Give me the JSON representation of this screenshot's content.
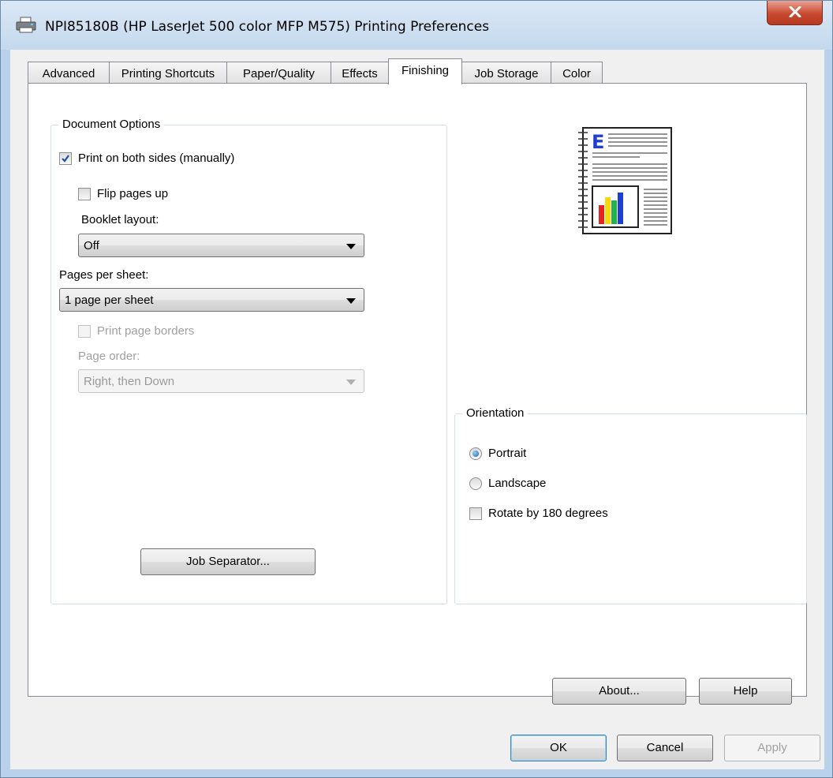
{
  "window": {
    "title": "NPI85180B (HP LaserJet 500 color MFP M575) Printing Preferences",
    "title_icon": "printer-icon",
    "close_icon": "close-icon"
  },
  "tabs": [
    {
      "label": "Advanced",
      "active": false
    },
    {
      "label": "Printing Shortcuts",
      "active": false
    },
    {
      "label": "Paper/Quality",
      "active": false
    },
    {
      "label": "Effects",
      "active": false
    },
    {
      "label": "Finishing",
      "active": true
    },
    {
      "label": "Job Storage",
      "active": false
    },
    {
      "label": "Color",
      "active": false
    }
  ],
  "document_options": {
    "group_label": "Document Options",
    "print_both_sides": {
      "label": "Print on both sides (manually)",
      "checked": true
    },
    "flip_pages_up": {
      "label": "Flip pages up",
      "checked": false
    },
    "booklet_layout": {
      "label": "Booklet layout:",
      "value": "Off"
    },
    "pages_per_sheet": {
      "label": "Pages per sheet:",
      "value": "1 page per sheet"
    },
    "print_page_borders": {
      "label": "Print page borders",
      "checked": false,
      "disabled": true
    },
    "page_order": {
      "label": "Page order:",
      "value": "Right, then Down",
      "disabled": true
    },
    "job_separator_button": "Job Separator..."
  },
  "preview": {
    "icon": "document-preview-icon",
    "letter": "E",
    "bar_colors": [
      "#e8231f",
      "#f5d90a",
      "#22b14c",
      "#1f3fd1"
    ]
  },
  "orientation": {
    "group_label": "Orientation",
    "portrait": {
      "label": "Portrait",
      "selected": true
    },
    "landscape": {
      "label": "Landscape",
      "selected": false
    },
    "rotate_180": {
      "label": "Rotate by 180 degrees",
      "checked": false
    }
  },
  "page_buttons": {
    "about": "About...",
    "help": "Help"
  },
  "dialog_buttons": {
    "ok": "OK",
    "cancel": "Cancel",
    "apply": "Apply"
  }
}
